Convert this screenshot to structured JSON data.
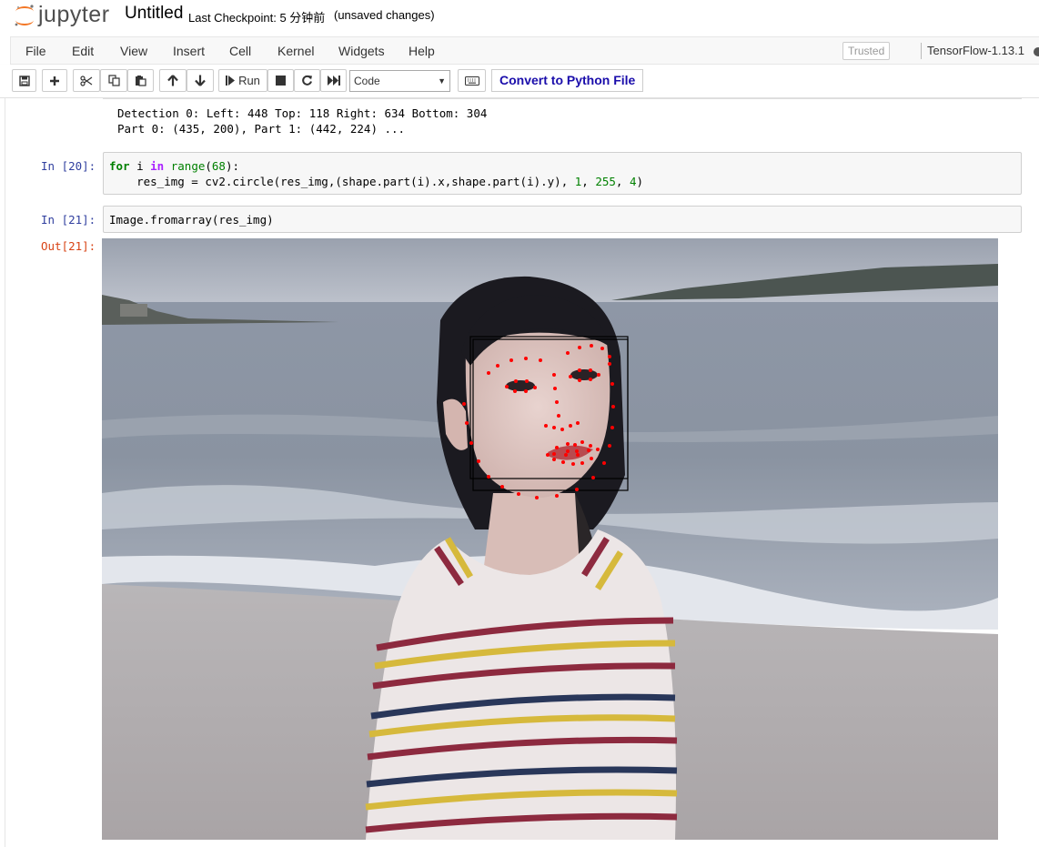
{
  "header": {
    "logo_text": "jupyter",
    "notebook_name": "Untitled",
    "checkpoint": "Last Checkpoint: 5 分钟前",
    "unsaved": "(unsaved changes)"
  },
  "menubar": {
    "items": [
      "File",
      "Edit",
      "View",
      "Insert",
      "Cell",
      "Kernel",
      "Widgets",
      "Help"
    ],
    "trusted": "Trusted",
    "kernel": "TensorFlow-1.13.1"
  },
  "toolbar": {
    "run_label": "Run",
    "cell_type": "Code",
    "convert_label": "Convert to Python File"
  },
  "cells": {
    "prev_output": {
      "line1": "Detection 0: Left: 448 Top: 118 Right: 634 Bottom: 304",
      "line2": "Part 0: (435, 200), Part 1: (442, 224) ..."
    },
    "cell20": {
      "prompt": "In  [20]:",
      "code_for": "for",
      "code_i": " i ",
      "code_in": "in",
      "code_range": " range",
      "code_args": "(68):",
      "line2_a": "    res_img = cv2.circle(res_img,(shape.part(i).x,shape.part(i).y), ",
      "line2_n1": "1",
      "line2_sep1": ", ",
      "line2_n2": "255",
      "line2_sep2": ", ",
      "line2_n3": "4",
      "line2_end": ")"
    },
    "cell21": {
      "prompt": "In  [21]:",
      "code": "Image.fromarray(res_img)",
      "out_prompt": "Out[21]:"
    }
  },
  "colors": {
    "landmark": "#ff0000",
    "prompt_in": "#303f9f",
    "prompt_out": "#d84315",
    "convert_link": "#1a0dab"
  }
}
